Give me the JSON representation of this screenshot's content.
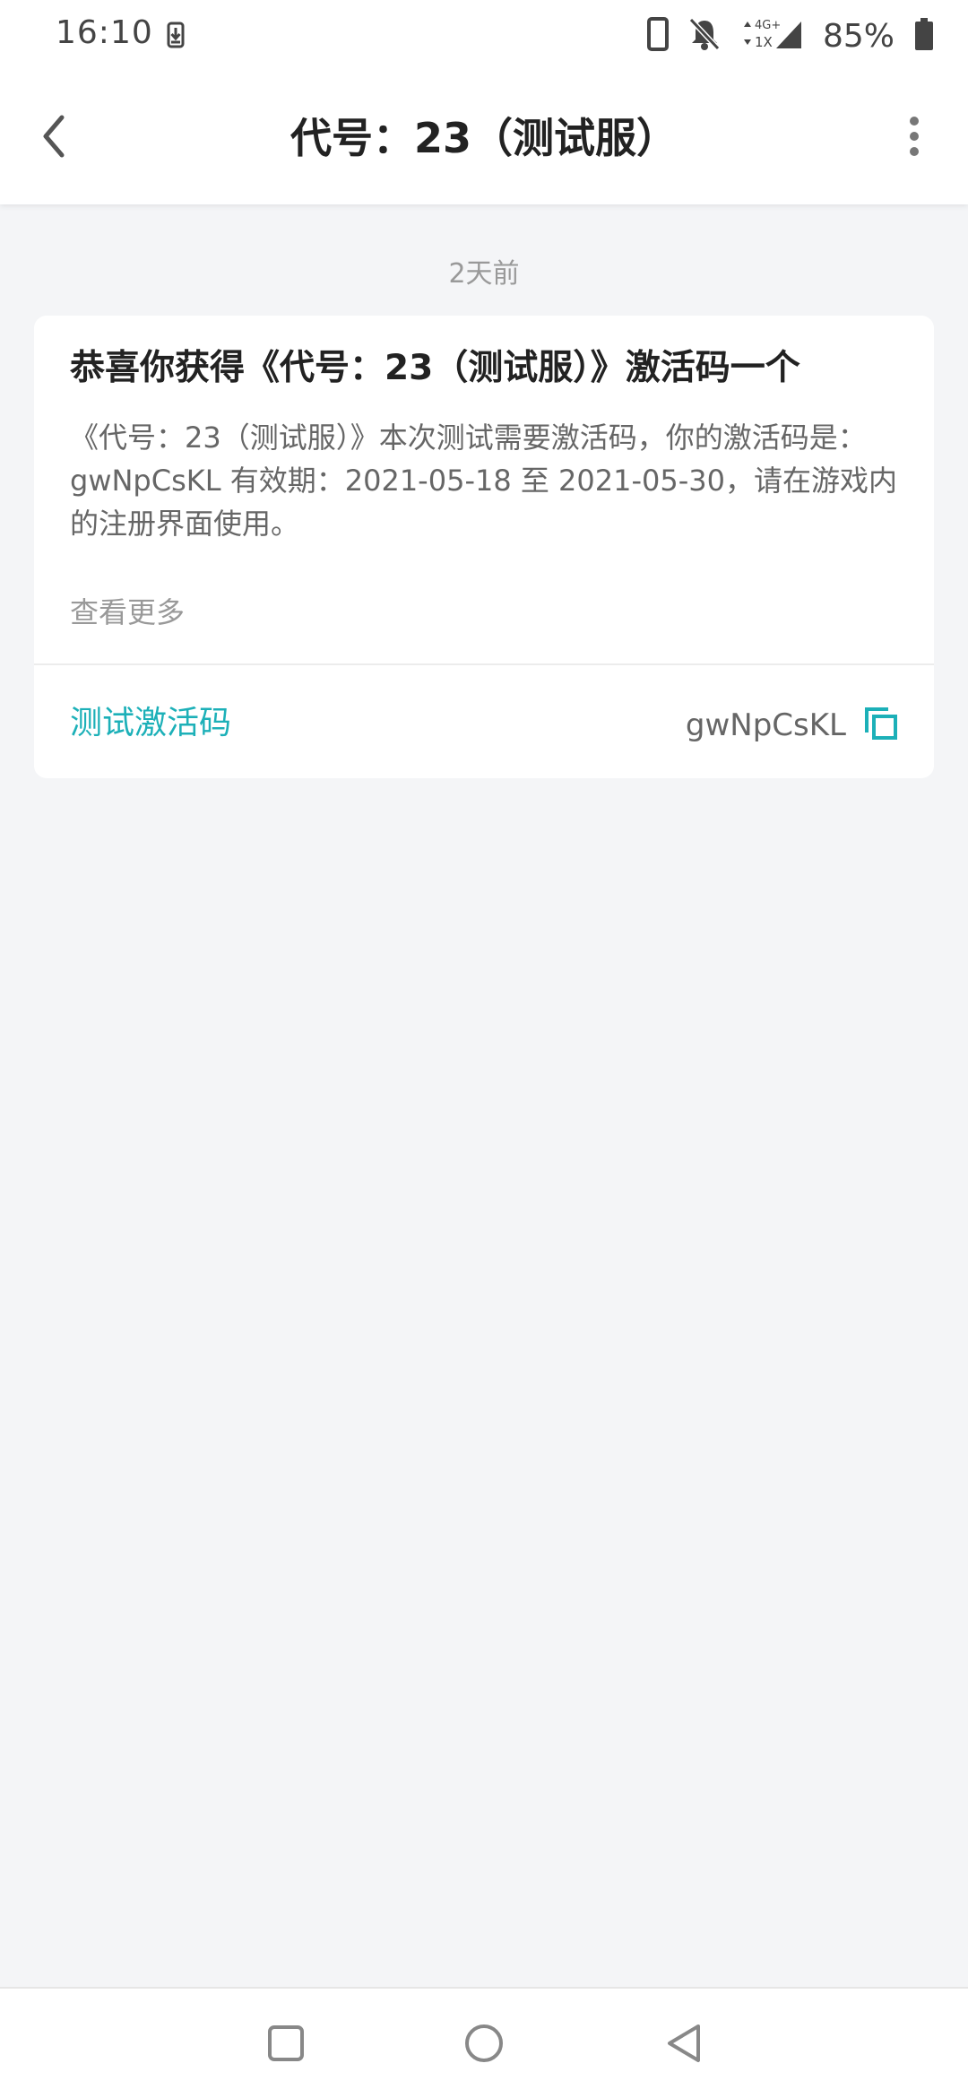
{
  "status_bar": {
    "time": "16:10",
    "battery": "85%",
    "network": "4G+ 1X",
    "icons": [
      "download-icon",
      "phone-icon",
      "bell-off-icon",
      "signal-icon",
      "battery-icon"
    ]
  },
  "toolbar": {
    "title": "代号：23（测试服）",
    "back_icon": "chevron-left-icon",
    "more_icon": "more-vertical-icon"
  },
  "message": {
    "timestamp": "2天前",
    "title": "恭喜你获得《代号：23（测试服）》激活码一个",
    "body": "《代号：23（测试服）》本次测试需要激活码，你的激活码是：gwNpCsKL 有效期：2021-05-18 至 2021-05-30，请在游戏内的注册界面使用。",
    "see_more": "查看更多",
    "code_label": "测试激活码",
    "code_value": "gwNpCsKL",
    "copy_icon": "copy-icon"
  },
  "colors": {
    "accent": "#1cb0b8",
    "background": "#f4f5f7",
    "card": "#ffffff",
    "title_text": "#222222",
    "body_text": "#666666",
    "muted_text": "#999999"
  },
  "nav_bar": {
    "buttons": [
      "recents-square-icon",
      "home-circle-icon",
      "back-triangle-icon"
    ]
  }
}
